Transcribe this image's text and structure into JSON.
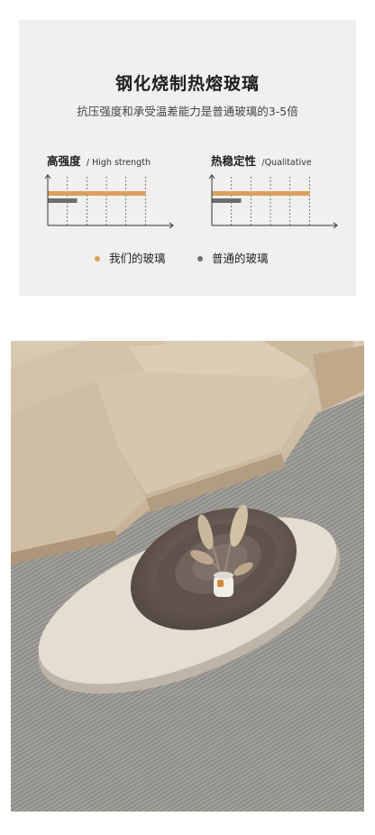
{
  "headline": "钢化烧制热熔玻璃",
  "subline": "抗压强度和承受温差能力是普通玻璃的3-5倍",
  "colors": {
    "ours": "#d9a05b",
    "normal": "#6e6e6e",
    "axis": "#333333"
  },
  "panels": [
    {
      "title_cn": "高强度",
      "title_en": "/ High strength"
    },
    {
      "title_cn": "热稳定性",
      "title_en": "/Qualitative"
    }
  ],
  "legend": {
    "ours": "我们的玻璃",
    "normal": "普通的玻璃"
  },
  "chart_data": [
    {
      "type": "bar",
      "title": "高强度 / High strength",
      "series": [
        {
          "name": "我们的玻璃",
          "values": [
            5
          ]
        },
        {
          "name": "普通的玻璃",
          "values": [
            1.5
          ]
        }
      ]
    },
    {
      "type": "bar",
      "title": "热稳定性 /Qualitative",
      "series": [
        {
          "name": "我们的玻璃",
          "values": [
            5
          ]
        },
        {
          "name": "普通的玻璃",
          "values": [
            1.5
          ]
        }
      ]
    }
  ]
}
